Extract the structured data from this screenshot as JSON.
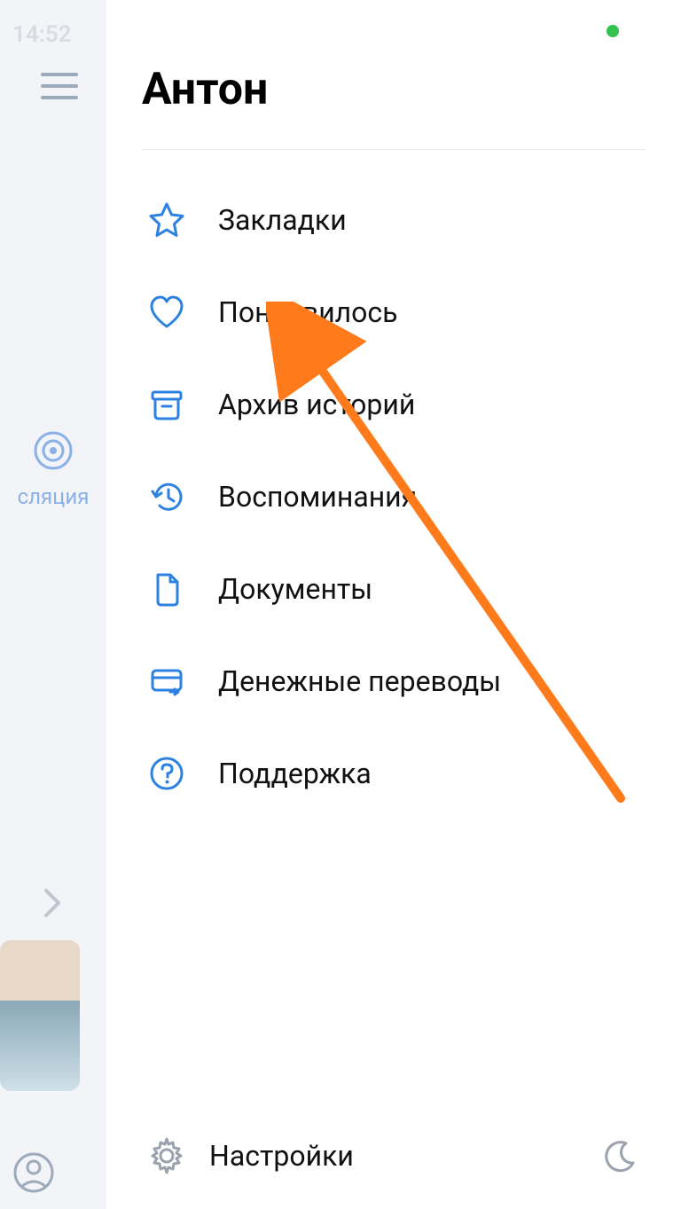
{
  "status_bar": {
    "time": "14:52"
  },
  "background": {
    "broadcast_label": "сляция"
  },
  "drawer": {
    "title": "Антон",
    "menu": [
      {
        "icon": "star-icon",
        "label": "Закладки"
      },
      {
        "icon": "heart-icon",
        "label": "Понравилось"
      },
      {
        "icon": "archive-icon",
        "label": "Архив историй"
      },
      {
        "icon": "history-icon",
        "label": "Воспоминания"
      },
      {
        "icon": "document-icon",
        "label": "Документы"
      },
      {
        "icon": "card-icon",
        "label": "Денежные переводы"
      },
      {
        "icon": "help-icon",
        "label": "Поддержка"
      }
    ],
    "footer": {
      "settings_label": "Настройки"
    }
  },
  "colors": {
    "icon_blue": "#2d81e0",
    "status_green": "#32c24d",
    "arrow": "#ff7a1a"
  }
}
